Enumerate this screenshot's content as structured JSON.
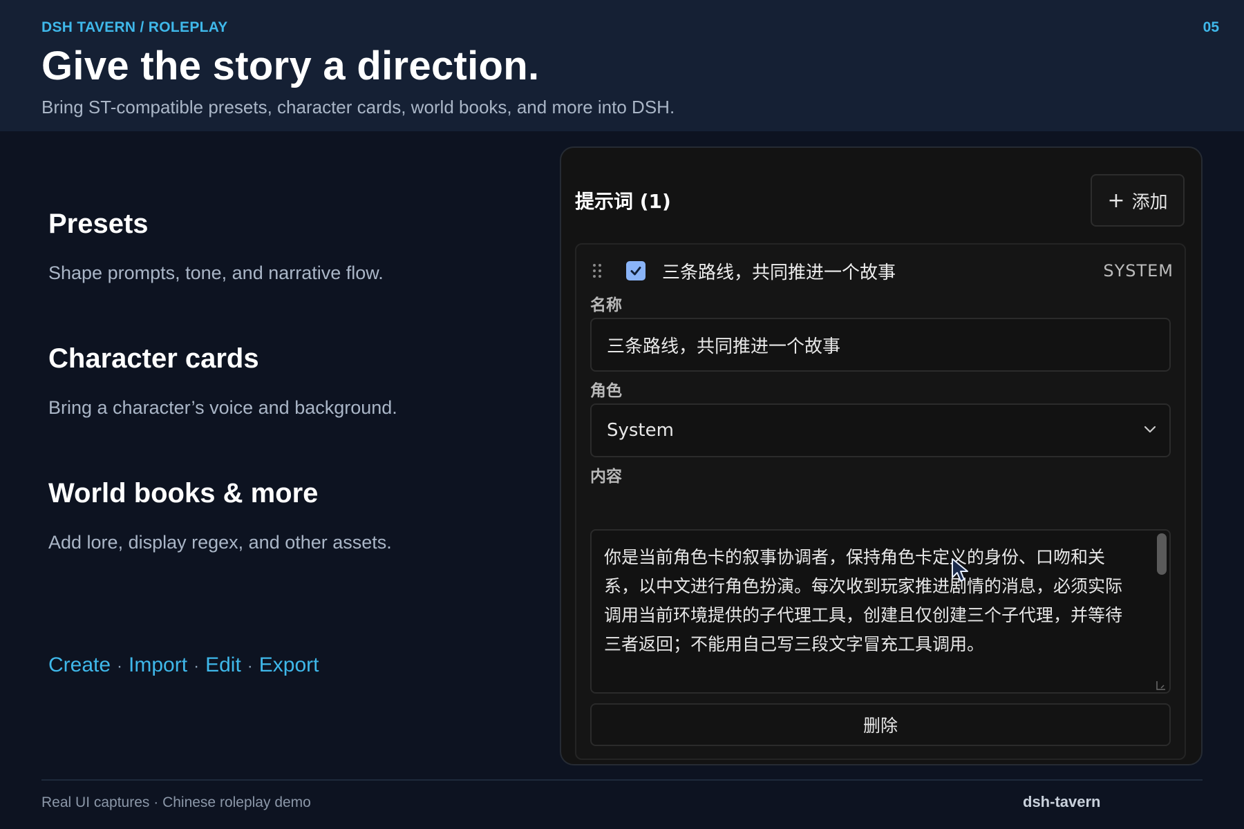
{
  "header": {
    "eyebrow": "DSH TAVERN / ROLEPLAY",
    "page_number": "05",
    "title": "Give the story a direction.",
    "subtitle": "Bring ST-compatible presets, character cards, world books, and more into DSH."
  },
  "features": [
    {
      "title": "Presets",
      "description": "Shape prompts, tone, and narrative flow."
    },
    {
      "title": "Character cards",
      "description": "Bring a character’s voice and background."
    },
    {
      "title": "World books & more",
      "description": "Add lore, display regex, and other assets."
    }
  ],
  "actions": {
    "items": [
      "Create",
      "Import",
      "Edit",
      "Export"
    ],
    "separator": "·"
  },
  "panel": {
    "title": "提示词 (1)",
    "add_button_icon": "+",
    "add_button_label": "添加",
    "entry": {
      "checked": true,
      "name": "三条路线，共同推进一个故事",
      "role_badge": "SYSTEM",
      "name_label": "名称",
      "name_value": "三条路线，共同推进一个故事",
      "role_label": "角色",
      "role_value": "System",
      "content_label": "内容",
      "content_value": "你是当前角色卡的叙事协调者，保持角色卡定义的身份、口吻和关系，以中文进行角色扮演。每次收到玩家推进剧情的消息，必须实际调用当前环境提供的子代理工具，创建且仅创建三个子代理，并等待三者返回；不能用自己写三段文字冒充工具调用。",
      "delete_label": "删除"
    }
  },
  "footer": {
    "left": "Real UI captures · Chinese roleplay demo",
    "right": "dsh-tavern"
  },
  "colors": {
    "accent": "#3fb8ea",
    "header_bg": "#152034",
    "page_bg": "#0d1321",
    "panel_bg": "#131313",
    "checkbox": "#8ab4f8"
  },
  "icons": [
    "drag-handle-icon",
    "checkbox-checked-icon",
    "chevron-down-icon",
    "resize-handle-icon",
    "mouse-cursor-icon",
    "plus-icon"
  ]
}
